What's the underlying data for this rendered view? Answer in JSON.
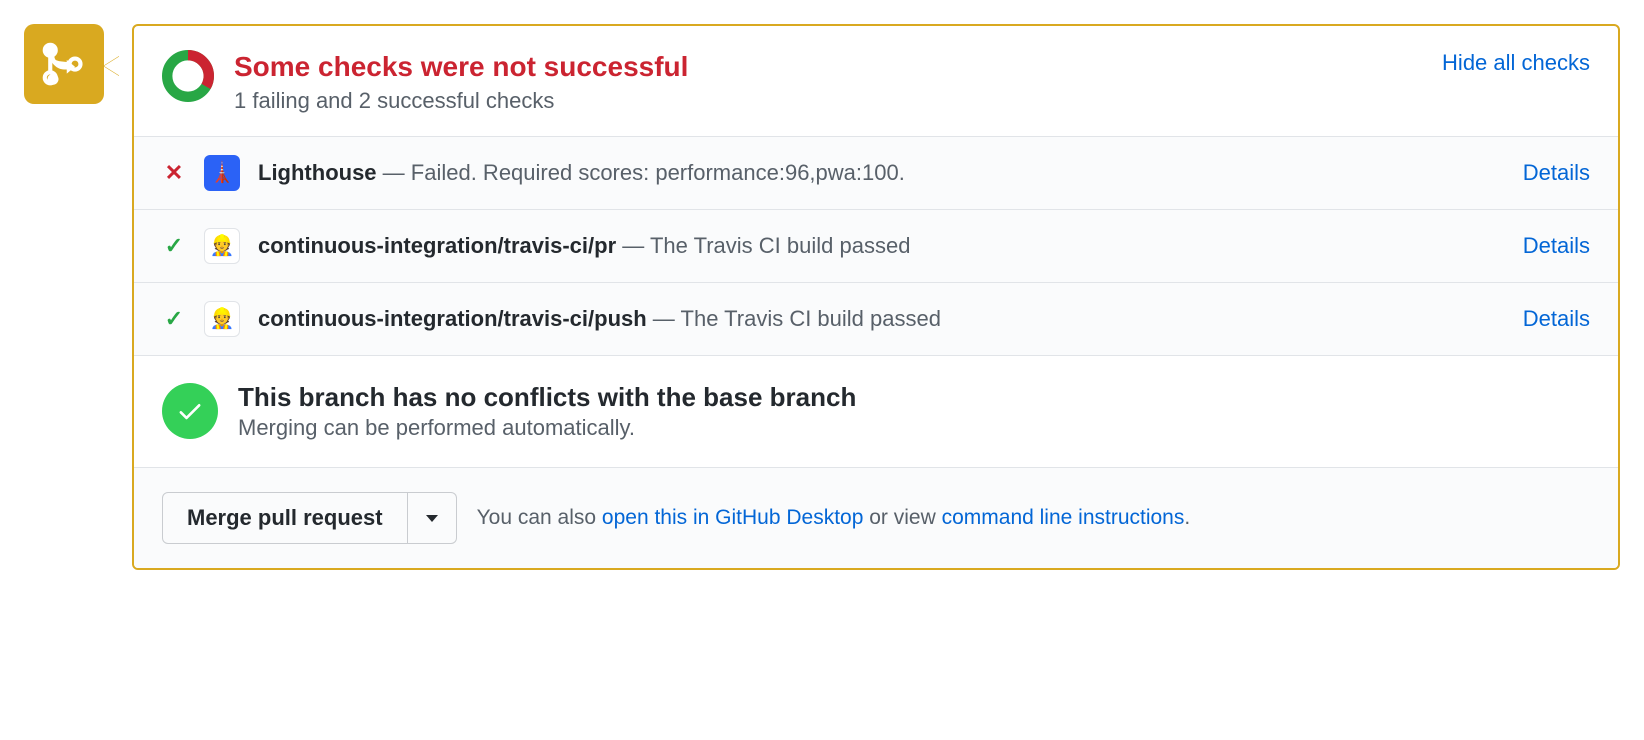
{
  "header": {
    "title": "Some checks were not successful",
    "subtitle": "1 failing and 2 successful checks",
    "hide_link": "Hide all checks"
  },
  "checks": [
    {
      "status": "fail",
      "service_icon": "lighthouse",
      "name": "Lighthouse",
      "sep": " — ",
      "message": "Failed. Required scores: performance:96,pwa:100.",
      "details_label": "Details"
    },
    {
      "status": "pass",
      "service_icon": "travis",
      "name": "continuous-integration/travis-ci/pr",
      "sep": " — ",
      "message": "The Travis CI build passed",
      "details_label": "Details"
    },
    {
      "status": "pass",
      "service_icon": "travis",
      "name": "continuous-integration/travis-ci/push",
      "sep": " — ",
      "message": "The Travis CI build passed",
      "details_label": "Details"
    }
  ],
  "conflict": {
    "title": "This branch has no conflicts with the base branch",
    "subtitle": "Merging can be performed automatically."
  },
  "merge": {
    "button_label": "Merge pull request",
    "help_prefix": "You can also ",
    "open_desktop": "open this in GitHub Desktop",
    "or_view": " or view ",
    "cmd_line": "command line instructions",
    "period": "."
  }
}
